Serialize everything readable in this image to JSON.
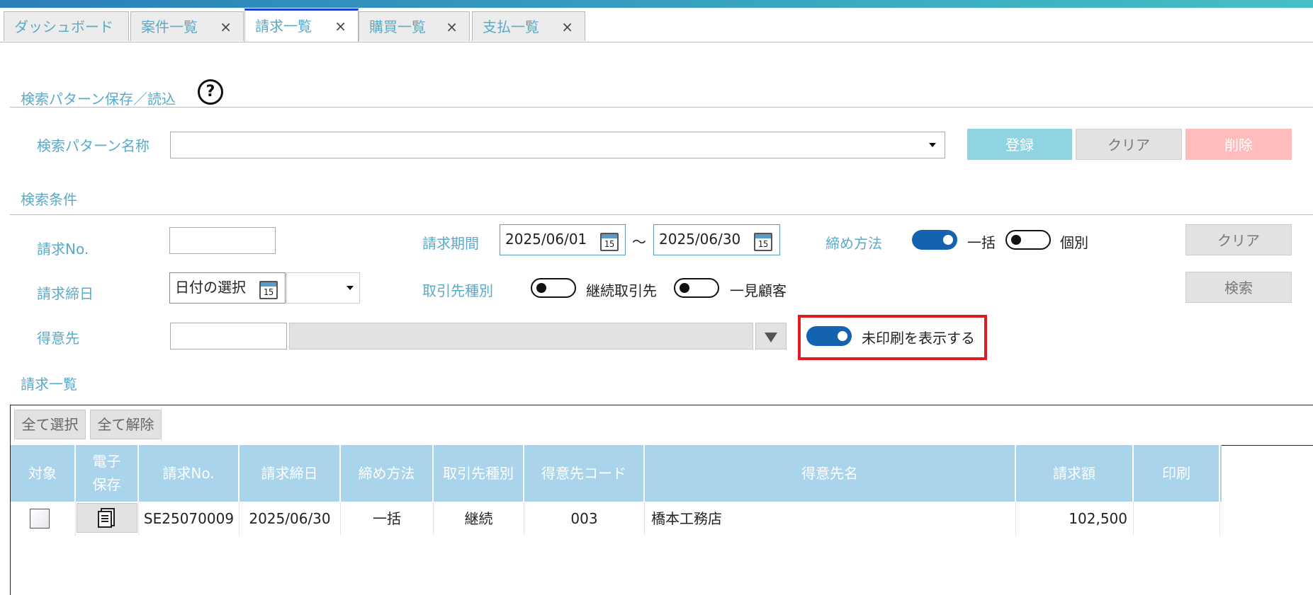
{
  "tabs": [
    {
      "label": "ダッシュボード",
      "closable": false
    },
    {
      "label": "案件一覧",
      "closable": true
    },
    {
      "label": "請求一覧",
      "closable": true,
      "active": true
    },
    {
      "label": "購買一覧",
      "closable": true
    },
    {
      "label": "支払一覧",
      "closable": true
    }
  ],
  "close_glyph": "×",
  "pattern": {
    "section_title": "検索パターン保存／読込",
    "help_icon": "?",
    "name_label": "検索パターン名称",
    "name_value": "",
    "register_label": "登録",
    "clear_label": "クリア",
    "delete_label": "削除"
  },
  "conditions": {
    "section_title": "検索条件",
    "invoice_no_label": "請求No.",
    "invoice_no_value": "",
    "period_label": "請求期間",
    "period_from": "2025/06/01",
    "period_separator": "～",
    "period_to": "2025/06/30",
    "calendar_day": "15",
    "closing_method_label": "締め方法",
    "closing_bulk_label": "一括",
    "closing_bulk_on": true,
    "closing_individual_label": "個別",
    "closing_individual_on": false,
    "clear_label": "クリア",
    "closing_date_label": "請求締日",
    "closing_date_placeholder": "日付の選択",
    "closing_date_select_value": "",
    "partner_type_label": "取引先種別",
    "partner_continuous_label": "継続取引先",
    "partner_continuous_on": false,
    "partner_oneoff_label": "一見顧客",
    "partner_oneoff_on": false,
    "search_label": "検索",
    "customer_label": "得意先",
    "customer_code_value": "",
    "customer_name_value": "",
    "unprinted_label": "未印刷を表示する",
    "unprinted_on": true
  },
  "list": {
    "section_title": "請求一覧",
    "select_all_label": "全て選択",
    "deselect_all_label": "全て解除",
    "columns": [
      "対象",
      "電子\n保存",
      "請求No.",
      "請求締日",
      "締め方法",
      "取引先種別",
      "得意先コード",
      "得意先名",
      "請求額",
      "印刷"
    ],
    "rows": [
      {
        "checked": false,
        "invoice_no": "SE25070009",
        "closing_date": "2025/06/30",
        "closing_method": "一括",
        "partner_type": "継続",
        "customer_code": "003",
        "customer_name": "橋本工務店",
        "amount": "102,500",
        "print": ""
      }
    ]
  },
  "colors": {
    "accent": "#5aaac8",
    "toggle_on": "#1463b0",
    "header_bg": "#a9d4ec",
    "highlight": "#e01b24"
  }
}
